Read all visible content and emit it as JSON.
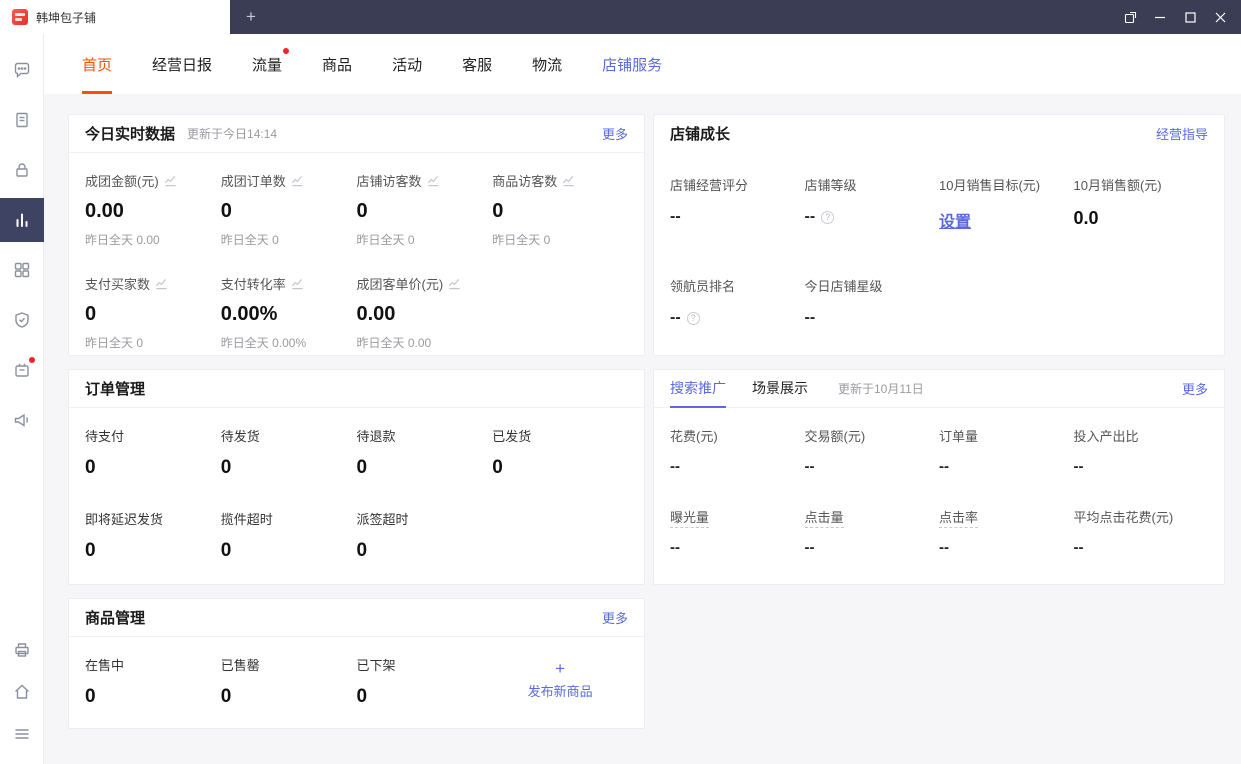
{
  "icons": {
    "help": "?",
    "plus": "+"
  },
  "colors": {
    "titlebar_bg": "#3a3d54",
    "accent_orange": "#ff5000",
    "accent_blue": "#5a6ade",
    "badge_red": "#f5222d",
    "sidebar_active_bg": "#3e4263"
  },
  "titlebar": {
    "tab_title": "韩坤包子铺",
    "new_tab": "+"
  },
  "nav": {
    "items": [
      {
        "label": "首页"
      },
      {
        "label": "经营日报"
      },
      {
        "label": "流量"
      },
      {
        "label": "商品"
      },
      {
        "label": "活动"
      },
      {
        "label": "客服"
      },
      {
        "label": "物流"
      },
      {
        "label": "店铺服务"
      }
    ]
  },
  "realtime": {
    "title": "今日实时数据",
    "updated": "更新于今日14:14",
    "more": "更多",
    "metrics": [
      {
        "label": "成团金额(元)",
        "value": "0.00",
        "sub": "昨日全天 0.00"
      },
      {
        "label": "成团订单数",
        "value": "0",
        "sub": "昨日全天 0"
      },
      {
        "label": "店铺访客数",
        "value": "0",
        "sub": "昨日全天 0"
      },
      {
        "label": "商品访客数",
        "value": "0",
        "sub": "昨日全天 0"
      },
      {
        "label": "支付买家数",
        "value": "0",
        "sub": "昨日全天 0"
      },
      {
        "label": "支付转化率",
        "value": "0.00%",
        "sub": "昨日全天 0.00%"
      },
      {
        "label": "成团客单价(元)",
        "value": "0.00",
        "sub": "昨日全天 0.00"
      }
    ]
  },
  "growth": {
    "title": "店铺成长",
    "link": "经营指导",
    "items": [
      {
        "label": "店铺经营评分",
        "value": "--"
      },
      {
        "label": "店铺等级",
        "value": "--"
      },
      {
        "label": "10月销售目标(元)",
        "value": "设置"
      },
      {
        "label": "10月销售额(元)",
        "value": "0.0"
      },
      {
        "label": "领航员排名",
        "value": "--"
      },
      {
        "label": "今日店铺星级",
        "value": "--"
      }
    ]
  },
  "orders": {
    "title": "订单管理",
    "items": [
      {
        "label": "待支付",
        "value": "0"
      },
      {
        "label": "待发货",
        "value": "0"
      },
      {
        "label": "待退款",
        "value": "0"
      },
      {
        "label": "已发货",
        "value": "0"
      },
      {
        "label": "即将延迟发货",
        "value": "0"
      },
      {
        "label": "揽件超时",
        "value": "0"
      },
      {
        "label": "派签超时",
        "value": "0"
      }
    ]
  },
  "promotion": {
    "tabs": [
      {
        "label": "搜索推广"
      },
      {
        "label": "场景展示"
      }
    ],
    "updated": "更新于10月11日",
    "more": "更多",
    "items": [
      {
        "label": "花费(元)",
        "value": "--"
      },
      {
        "label": "交易额(元)",
        "value": "--"
      },
      {
        "label": "订单量",
        "value": "--"
      },
      {
        "label": "投入产出比",
        "value": "--"
      },
      {
        "label": "曝光量",
        "value": "--"
      },
      {
        "label": "点击量",
        "value": "--"
      },
      {
        "label": "点击率",
        "value": "--"
      },
      {
        "label": "平均点击花费(元)",
        "value": "--"
      }
    ]
  },
  "products": {
    "title": "商品管理",
    "more": "更多",
    "items": [
      {
        "label": "在售中",
        "value": "0"
      },
      {
        "label": "已售罄",
        "value": "0"
      },
      {
        "label": "已下架",
        "value": "0"
      }
    ],
    "publish_label": "发布新商品"
  }
}
